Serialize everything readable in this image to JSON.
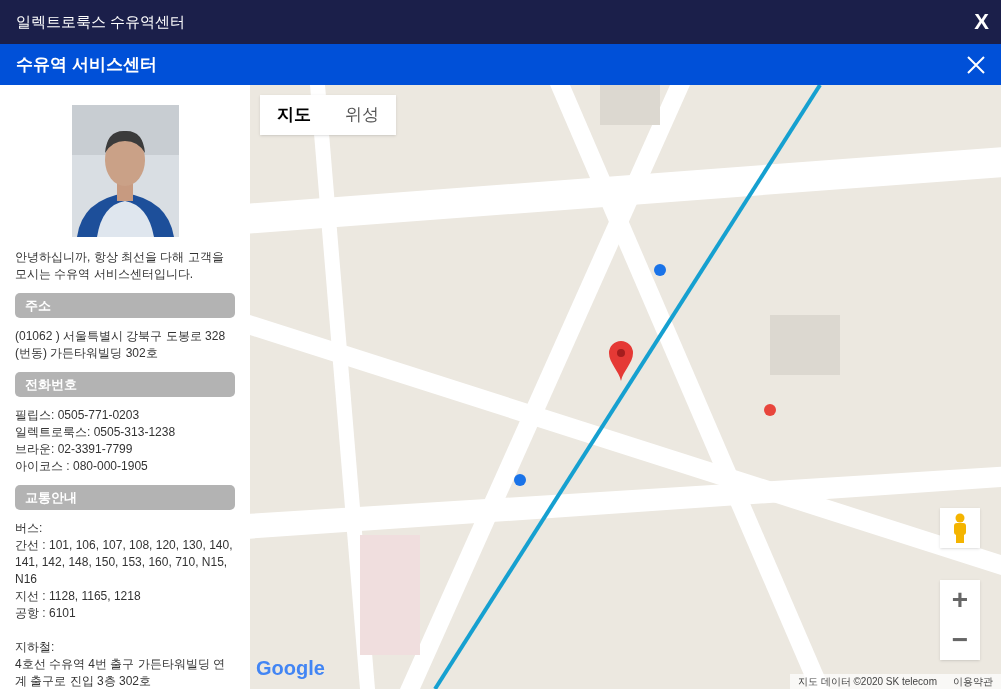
{
  "window": {
    "title": "일렉트로룩스 수유역센터",
    "close": "X"
  },
  "dialog": {
    "title": "수유역 서비스센터"
  },
  "info": {
    "greeting": "안녕하십니까, 항상 최선을 다해 고객을 모시는 수유역 서비스센터입니다.",
    "sections": [
      {
        "heading": "주소",
        "blocks": [
          [
            "(01062 ) 서울특별시 강북구 도봉로 328",
            "(번동) 가든타워빌딩 302호"
          ]
        ]
      },
      {
        "heading": "전화번호",
        "blocks": [
          [
            "필립스: 0505-771-0203",
            "일렉트로룩스: 0505-313-1238",
            "브라운: 02-3391-7799",
            "아이코스 : 080-000-1905"
          ]
        ]
      },
      {
        "heading": "교통안내",
        "blocks": [
          [
            "버스:",
            "간선 : 101, 106, 107, 108, 120, 130, 140, 141, 142, 148, 150, 153, 160, 710, N15, N16",
            "지선 : 1128, 1165, 1218",
            "공항 : 6101"
          ],
          [
            "지하철:",
            "4호선 수유역 4번 출구 가든타워빌딩 연계 출구로 진입 3층 302호"
          ]
        ]
      }
    ]
  },
  "map": {
    "tabs": [
      {
        "label": "지도",
        "selected": true
      },
      {
        "label": "위성",
        "selected": false
      }
    ],
    "zoom_in": "+",
    "zoom_out": "−",
    "logo": "Google",
    "attribution": "지도 데이터 ©2020 SK telecom",
    "terms": "이용약관"
  }
}
